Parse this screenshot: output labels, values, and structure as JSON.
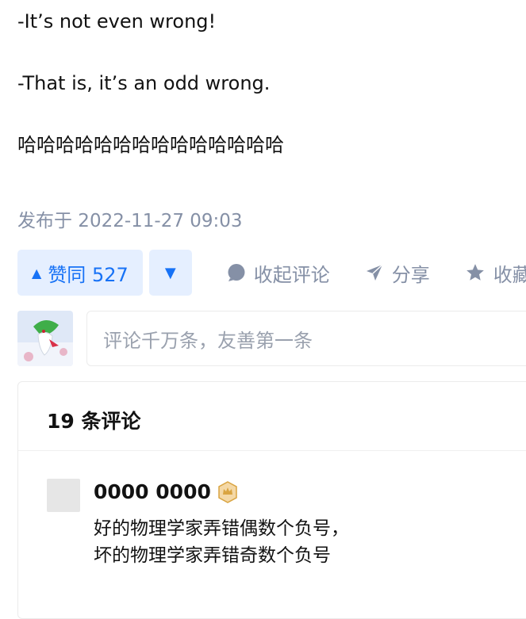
{
  "answer": {
    "lines": [
      "-It’s not even wrong!",
      "-That is, it’s an odd wrong.",
      "哈哈哈哈哈哈哈哈哈哈哈哈哈哈"
    ],
    "meta": "发布于 2022-11-27 09:03"
  },
  "actions": {
    "vote_up_label": "赞同 527",
    "vote_up_icon": "triangle-up-icon",
    "vote_down_icon": "triangle-down-icon",
    "collapse_comments_label": "收起评论",
    "share_label": "分享",
    "favorite_label": "收藏"
  },
  "comment_box": {
    "placeholder": "评论千万条，友善第一条"
  },
  "comments": {
    "count_label": "19 条评论",
    "items": [
      {
        "author": "0000 0000",
        "badge_icon": "crown-badge-icon",
        "text_lines": [
          "好的物理学家弄错偶数个负号，",
          "坏的物理学家弄错奇数个负号"
        ]
      }
    ]
  },
  "colors": {
    "accent": "#1772f6",
    "accent_bg": "#e5efff",
    "muted": "#8590a6",
    "badge_gold": "#d9a441"
  }
}
